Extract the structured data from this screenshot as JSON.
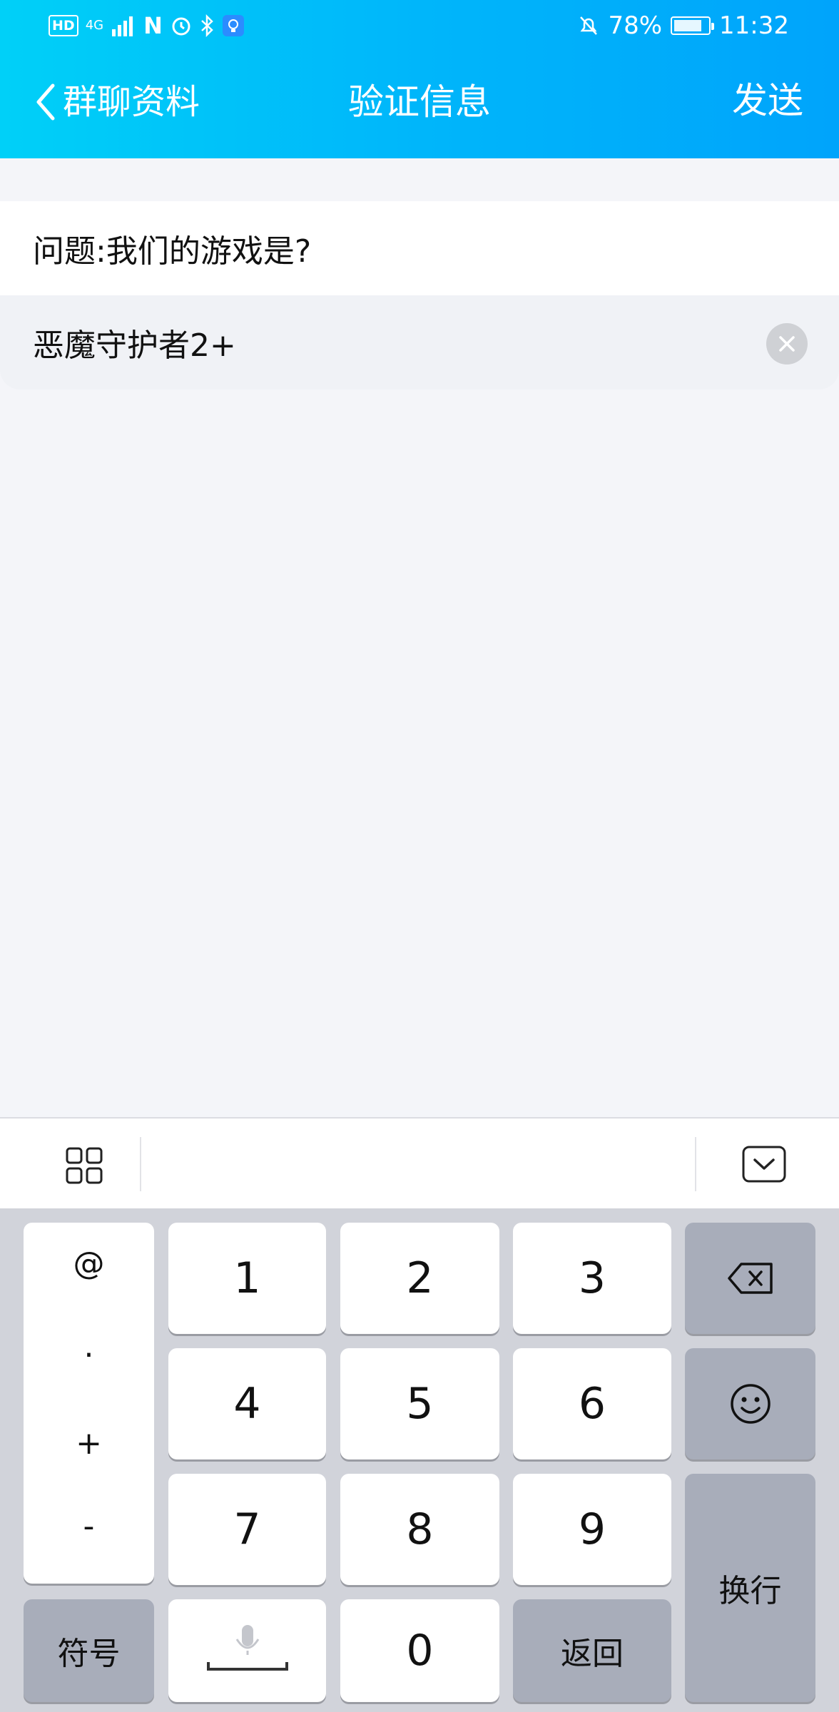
{
  "status_bar": {
    "hd": "HD",
    "network": "4G",
    "nfc": "N",
    "battery_percent": "78%",
    "battery_level": 0.78,
    "time": "11:32"
  },
  "nav": {
    "back_label": "群聊资料",
    "title": "验证信息",
    "send_label": "发送"
  },
  "form": {
    "question": "问题:我们的游戏是?",
    "answer": "恶魔守护者2+"
  },
  "keyboard": {
    "symbols": [
      "@",
      ".",
      "+",
      "-"
    ],
    "digits_row1": [
      "1",
      "2",
      "3"
    ],
    "digits_row2": [
      "4",
      "5",
      "6"
    ],
    "digits_row3": [
      "7",
      "8",
      "9"
    ],
    "zero": "0",
    "symbol_key": "符号",
    "return_key": "返回",
    "newline_key": "换行"
  },
  "colors": {
    "header_start": "#00d0f8",
    "header_end": "#00a4fb",
    "keyboard_bg": "#d1d3da",
    "key_gray": "#a8adba"
  }
}
